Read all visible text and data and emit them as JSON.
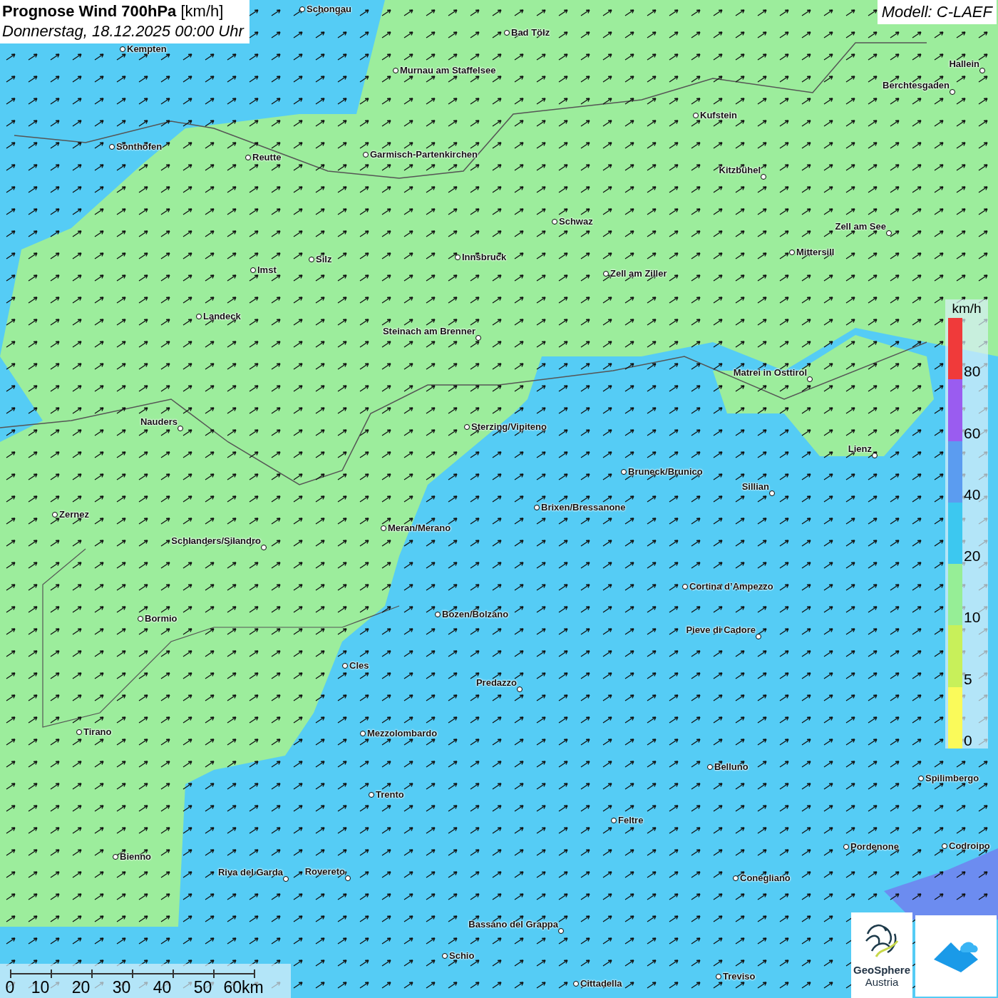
{
  "header": {
    "title": "Prognose Wind 700hPa",
    "unit": "[km/h]",
    "subtitle": "Donnerstag, 18.12.2025 00:00 Uhr"
  },
  "model": "Modell: C-LAEF",
  "cities": [
    {
      "name": "Schongau"
    },
    {
      "name": "Bad Tölz"
    },
    {
      "name": "Kempten"
    },
    {
      "name": "Murnau am Staffelsee"
    },
    {
      "name": "Hallein"
    },
    {
      "name": "Berchtesgaden"
    },
    {
      "name": "Kufstein"
    },
    {
      "name": "Sonthofen"
    },
    {
      "name": "Reutte"
    },
    {
      "name": "Garmisch-Partenkirchen"
    },
    {
      "name": "Kitzbühel"
    },
    {
      "name": "Schwaz"
    },
    {
      "name": "Zell am See"
    },
    {
      "name": "Mittersill"
    },
    {
      "name": "Innsbruck"
    },
    {
      "name": "Silz"
    },
    {
      "name": "Imst"
    },
    {
      "name": "Zell am Ziller"
    },
    {
      "name": "Landeck"
    },
    {
      "name": "Steinach am Brenner"
    },
    {
      "name": "Matrei in Osttirol"
    },
    {
      "name": "Nauders"
    },
    {
      "name": "Sterzing/Vipiteno"
    },
    {
      "name": "Lienz"
    },
    {
      "name": "Bruneck/Brunico"
    },
    {
      "name": "Sillian"
    },
    {
      "name": "Brixen/Bressanone"
    },
    {
      "name": "Zernez"
    },
    {
      "name": "Meran/Merano"
    },
    {
      "name": "Schlanders/Silandro"
    },
    {
      "name": "Cortina d’Ampezzo"
    },
    {
      "name": "Bozen/Bolzano"
    },
    {
      "name": "Bormio"
    },
    {
      "name": "Pieve di Cadore"
    },
    {
      "name": "Cles"
    },
    {
      "name": "Predazzo"
    },
    {
      "name": "Tirano"
    },
    {
      "name": "Mezzolombardo"
    },
    {
      "name": "Belluno"
    },
    {
      "name": "Spilimbergo"
    },
    {
      "name": "Trento"
    },
    {
      "name": "Feltre"
    },
    {
      "name": "Pordenone"
    },
    {
      "name": "Codroipo"
    },
    {
      "name": "Bienno"
    },
    {
      "name": "Riva del Garda"
    },
    {
      "name": "Rovereto"
    },
    {
      "name": "Conegliano"
    },
    {
      "name": "Bassano del Grappa"
    },
    {
      "name": "Schio"
    },
    {
      "name": "Treviso"
    },
    {
      "name": "Cittadella"
    }
  ],
  "legend": {
    "unit": "km/h",
    "bands": [
      {
        "label": "80",
        "color": "#f03a3a"
      },
      {
        "label": "60",
        "color": "#9a5cf0"
      },
      {
        "label": "40",
        "color": "#5b9cf0"
      },
      {
        "label": "20",
        "color": "#3cc8f0"
      },
      {
        "label": "10",
        "color": "#96ee96"
      },
      {
        "label": "5",
        "color": "#c8f05a"
      },
      {
        "label": "0",
        "color": "#fafa5a"
      }
    ]
  },
  "scale": {
    "labels": [
      "0",
      "10",
      "20",
      "30",
      "40",
      "50",
      "60km"
    ]
  },
  "logo": {
    "name": "GeoSphere",
    "country": "Austria"
  }
}
